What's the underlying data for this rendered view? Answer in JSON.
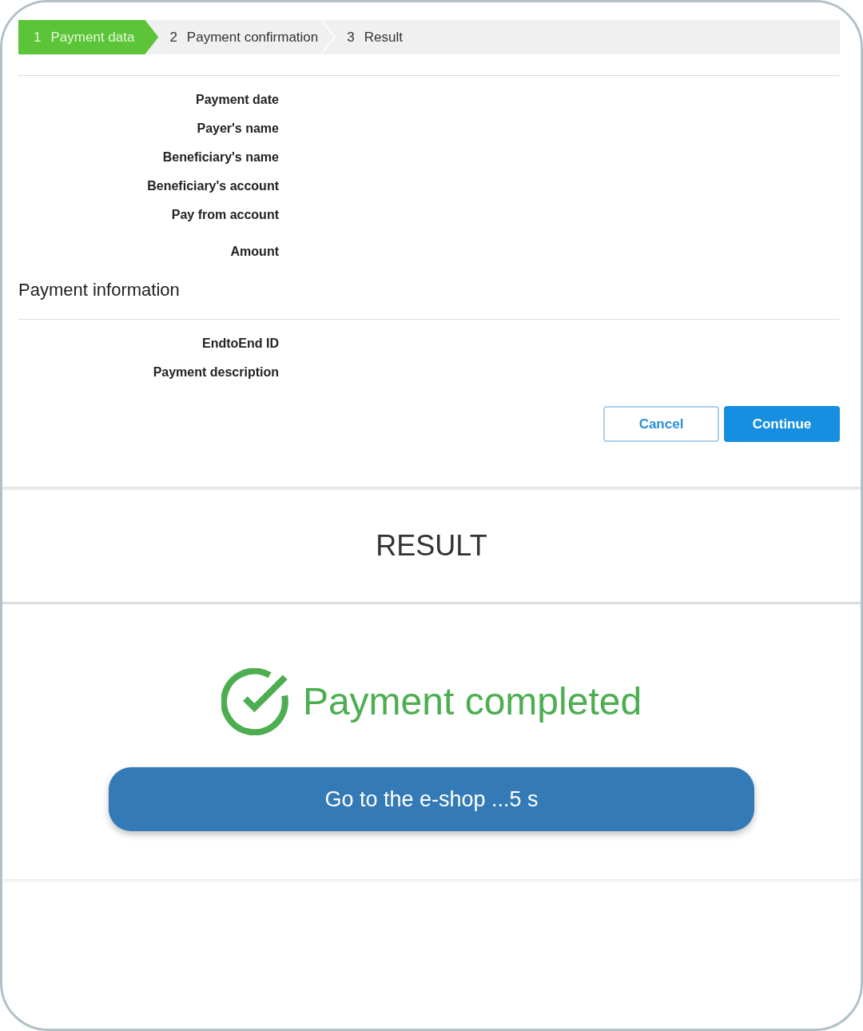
{
  "steps": [
    {
      "number": "1",
      "label": "Payment data",
      "selected": true
    },
    {
      "number": "2",
      "label": "Payment confirmation",
      "selected": false
    },
    {
      "number": "3",
      "label": "Result",
      "selected": false
    }
  ],
  "payment_fields": [
    "Payment date",
    "Payer's name",
    "Beneficiary's name",
    "Beneficiary's account",
    "Pay from account",
    "Amount"
  ],
  "payment_information": {
    "title": "Payment information",
    "fields": [
      "EndtoEnd ID",
      "Payment description"
    ]
  },
  "buttons": [
    {
      "label": "Cancel",
      "kind": "secondary"
    },
    {
      "label": "Continue",
      "kind": "primary"
    }
  ],
  "result": {
    "title": "RESULT",
    "status": {
      "kind": "success",
      "message": "Payment completed"
    },
    "action": {
      "label": "Go to the e-shop ...5 s"
    }
  }
}
